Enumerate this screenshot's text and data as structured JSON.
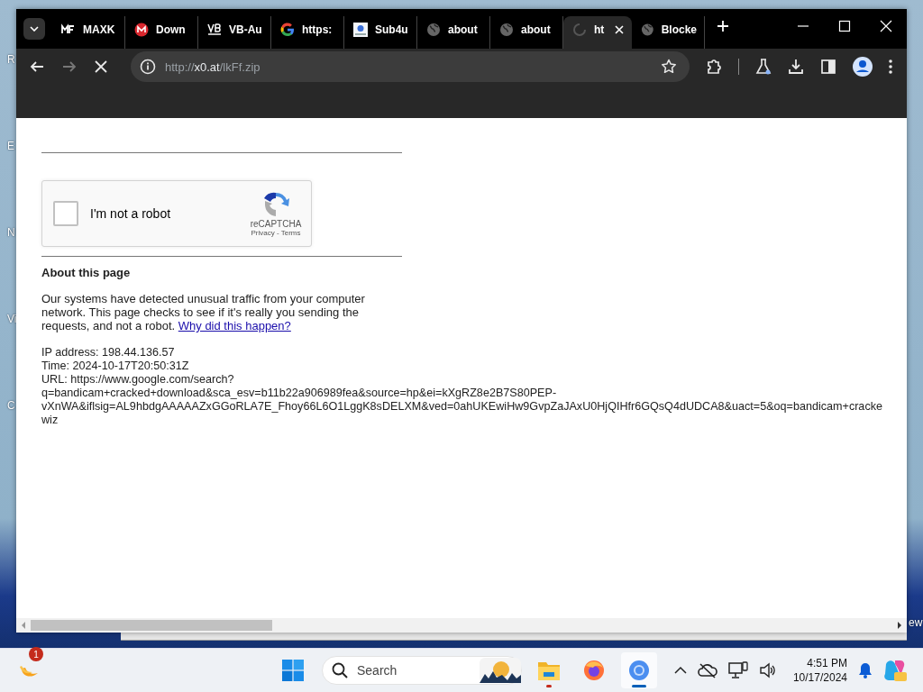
{
  "desktop": {
    "left_labels": [
      "R",
      "E",
      "N",
      "Vi",
      "C"
    ],
    "right_label": "ew"
  },
  "browser": {
    "tabs": [
      {
        "title": "MAXK",
        "kind": "mf",
        "selected": false
      },
      {
        "title": "Down",
        "kind": "mega",
        "selected": false
      },
      {
        "title": "VB-Au",
        "kind": "vb",
        "selected": false
      },
      {
        "title": "https:",
        "kind": "google",
        "selected": false
      },
      {
        "title": "Sub4u",
        "kind": "sub4u",
        "selected": false
      },
      {
        "title": "about",
        "kind": "globe",
        "selected": false
      },
      {
        "title": "about",
        "kind": "globe",
        "selected": false
      },
      {
        "title": "ht",
        "kind": "loading",
        "selected": true
      },
      {
        "title": "Blocke",
        "kind": "globe",
        "selected": false
      }
    ],
    "loading": true,
    "address": "http://**x0.at**/lkFf.zip",
    "page": {
      "captcha": {
        "label": "I'm not a robot",
        "checked": false,
        "brand": "reCAPTCHA",
        "links": "Privacy - Terms"
      },
      "heading": "About this page",
      "paragraph": "Our systems have detected unusual traffic from your computer network. This page checks to see if it's really you sending the requests, and not a robot.",
      "link": "Why did this happen?",
      "details": [
        "IP address: 198.44.136.57",
        "Time: 2024-10-17T20:50:31Z",
        "URL: https://www.google.com/search?",
        "q=bandicam+cracked+download&sca_esv=b11b22a906989fea&source=hp&ei=kXgRZ8e2B7S80PEP-",
        "vXnWA&iflsig=AL9hbdgAAAAAZxGGoRLA7E_Fhoy66L6O1LggK8sDELXM&ved=0ahUKEwiHw9GvpZaJAxU0HjQIHfr6GQsQ4dUDCA8&uact=5&oq=bandicam+cracke",
        "wiz"
      ]
    }
  },
  "taskbar": {
    "widget_badge": "1",
    "search_placeholder": "Search",
    "apps": [
      {
        "kind": "explorer",
        "active": false,
        "running": true
      },
      {
        "kind": "firefox",
        "active": false,
        "running": false
      },
      {
        "kind": "chrome",
        "active": true,
        "running": true
      }
    ],
    "time": "4:51 PM",
    "date": "10/17/2024"
  }
}
